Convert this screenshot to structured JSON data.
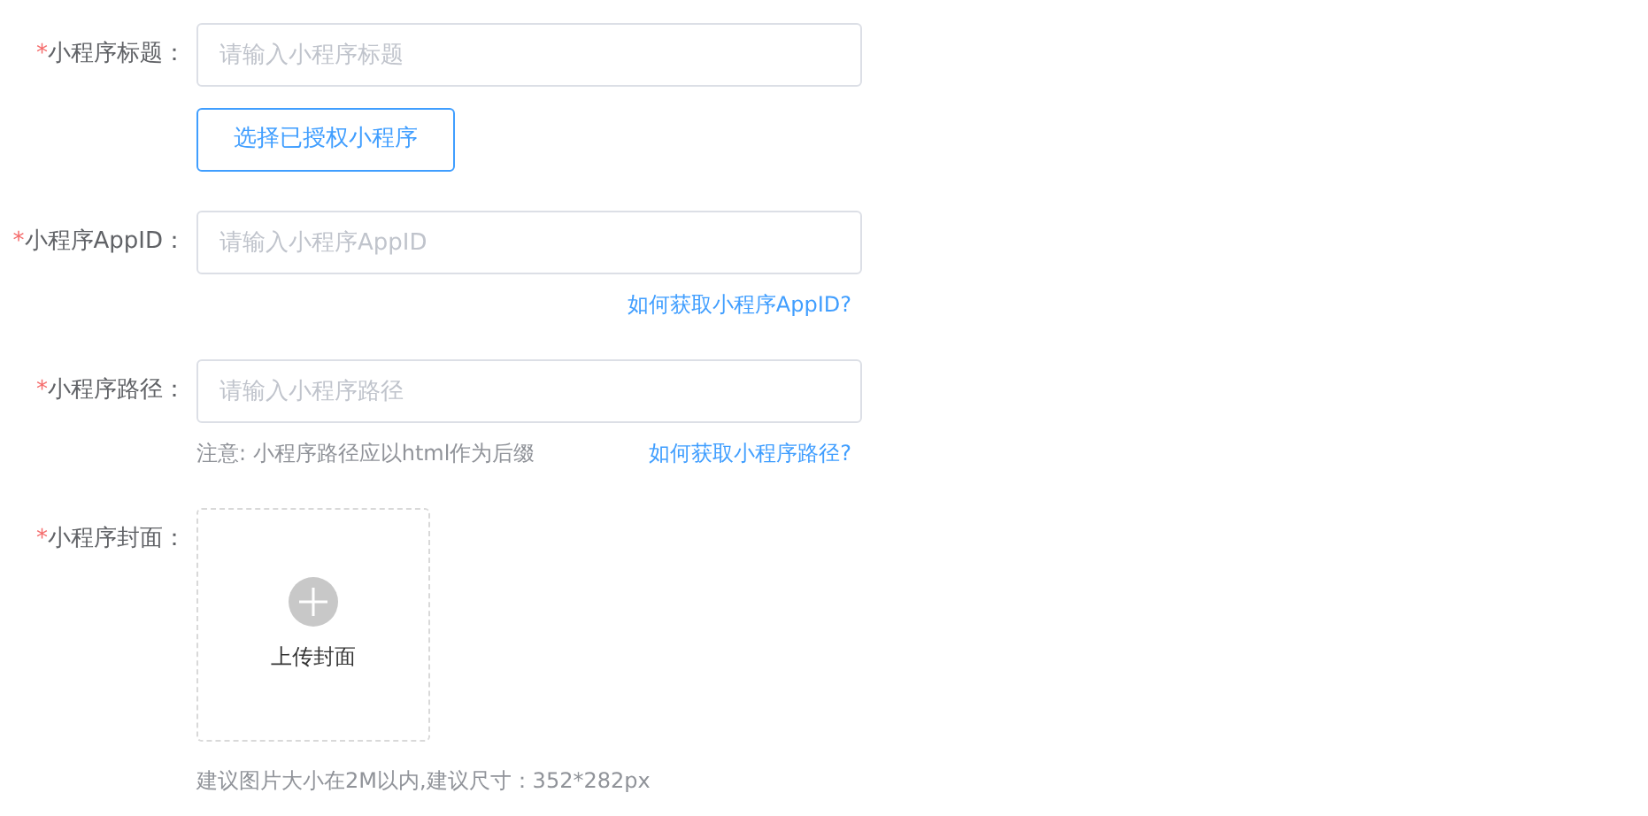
{
  "form": [
    {
      "kind": "input",
      "required_mark": "*",
      "label": "小程序标题：",
      "placeholder": "请输入小程序标题",
      "button": "选择已授权小程序"
    },
    {
      "kind": "input",
      "required_mark": "*",
      "label": "小程序AppID：",
      "placeholder": "请输入小程序AppID",
      "help_link": "如何获取小程序AppID?"
    },
    {
      "kind": "input",
      "required_mark": "*",
      "label": "小程序路径：",
      "placeholder": "请输入小程序路径",
      "note": "注意: 小程序路径应以html作为后缀",
      "help_link": "如何获取小程序路径?"
    },
    {
      "kind": "upload",
      "required_mark": "*",
      "label": "小程序封面：",
      "upload_text": "上传封面",
      "note": "建议图片大小在2M以内,建议尺寸：352*282px"
    }
  ]
}
